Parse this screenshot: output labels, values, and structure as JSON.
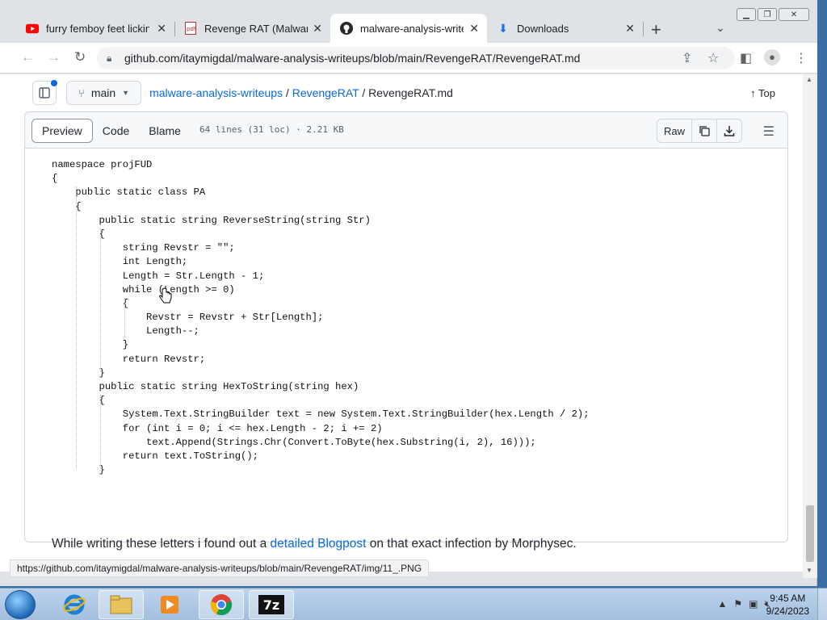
{
  "browser": {
    "tabs": [
      {
        "title": "furry femboy feet licking",
        "icon": "youtube-icon"
      },
      {
        "title": "Revenge RAT (Malware",
        "icon": "pdf-site-icon"
      },
      {
        "title": "malware-analysis-writeup",
        "icon": "github-icon",
        "active": true
      },
      {
        "title": "Downloads",
        "icon": "download-icon"
      }
    ],
    "url": "github.com/itaymigdal/malware-analysis-writeups/blob/main/RevengeRAT/RevengeRAT.md"
  },
  "github": {
    "branch": "main",
    "breadcrumb": {
      "repo": "malware-analysis-writeups",
      "sep1": "/",
      "folder": "RevengeRAT",
      "sep2": "/",
      "file": "RevengeRAT.md"
    },
    "top_label": "Top",
    "view_tabs": {
      "preview": "Preview",
      "code": "Code",
      "blame": "Blame"
    },
    "file_meta": "64 lines (31 loc) · 2.21 KB",
    "raw_label": "Raw"
  },
  "code_lines": [
    "namespace projFUD",
    "{",
    "    public static class PA",
    "    {",
    "        public static string ReverseString(string Str)",
    "        {",
    "            string Revstr = \"\";",
    "            int Length;",
    "            Length = Str.Length - 1;",
    "            while (Length >= 0)",
    "            {",
    "                Revstr = Revstr + Str[Length];",
    "                Length--;",
    "            }",
    "            return Revstr;",
    "        }",
    "        public static string HexToString(string hex)",
    "        {",
    "            System.Text.StringBuilder text = new System.Text.StringBuilder(hex.Length / 2);",
    "            for (int i = 0; i <= hex.Length - 2; i += 2)",
    "                text.Append(Strings.Chr(Convert.ToByte(hex.Substring(i, 2), 16)));",
    "            return text.ToString();",
    "        }"
  ],
  "prose": {
    "before": "While writing these letters i found out a ",
    "link": "detailed Blogpost",
    "after": " on that exact infection by Morphysec."
  },
  "status_url": "https://github.com/itaymigdal/malware-analysis-writeups/blob/main/RevengeRAT/img/11_.PNG",
  "clock": {
    "time": "9:45 AM",
    "date": "9/24/2023"
  }
}
